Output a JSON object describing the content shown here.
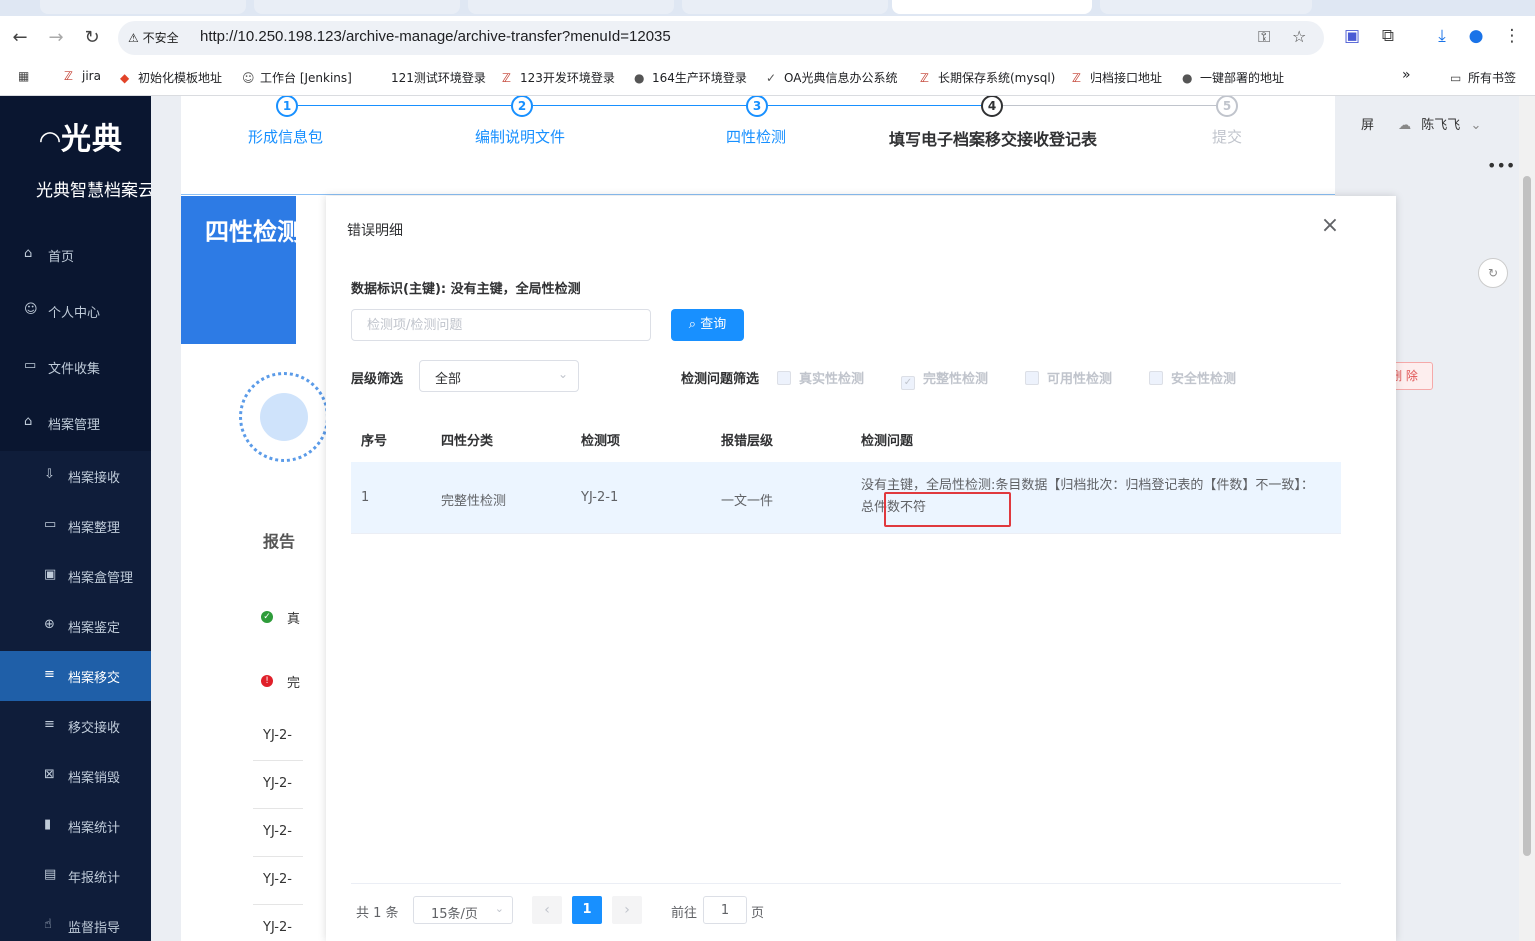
{
  "browser": {
    "insecure_label": "不安全",
    "url": "http://10.250.198.123/archive-manage/archive-transfer?menuId=12035",
    "bookmarks": [
      "jira",
      "初始化模板地址",
      "工作台 [Jenkins]",
      "121测试环境登录",
      "123开发环境登录",
      "164生产环境登录",
      "OA光典信息办公系统",
      "长期保存系统(mysql)",
      "归档接口地址",
      "一键部署的地址"
    ],
    "all_bookmarks": "所有书签",
    "more": "»"
  },
  "sidebar": {
    "logo": "光典",
    "subtitle": "光典智慧档案云",
    "items": [
      {
        "label": "首页",
        "icon": "home-icon",
        "glyph": "⌂"
      },
      {
        "label": "个人中心",
        "icon": "user-icon",
        "glyph": "☺"
      },
      {
        "label": "文件收集",
        "icon": "briefcase-icon",
        "glyph": "▭"
      },
      {
        "label": "档案管理",
        "icon": "bank-icon",
        "glyph": "⌂"
      }
    ],
    "sub_items": [
      {
        "label": "档案接收",
        "icon": "receive-icon",
        "glyph": "⇩"
      },
      {
        "label": "档案整理",
        "icon": "folder-icon",
        "glyph": "▭"
      },
      {
        "label": "档案盒管理",
        "icon": "box-icon",
        "glyph": "▣"
      },
      {
        "label": "档案鉴定",
        "icon": "appraise-icon",
        "glyph": "⊕"
      },
      {
        "label": "档案移交",
        "icon": "list-icon",
        "glyph": "≡"
      },
      {
        "label": "移交接收",
        "icon": "list-icon",
        "glyph": "≡"
      },
      {
        "label": "档案销毁",
        "icon": "destroy-icon",
        "glyph": "⊠"
      },
      {
        "label": "档案统计",
        "icon": "chart-icon",
        "glyph": "▮"
      },
      {
        "label": "年报统计",
        "icon": "report-icon",
        "glyph": "▤"
      },
      {
        "label": "监督指导",
        "icon": "guide-icon",
        "glyph": "☝"
      }
    ]
  },
  "header": {
    "fullscreen": "屏",
    "user": "陈飞飞",
    "delete_label": "删 除"
  },
  "steps": [
    {
      "num": "1",
      "label": "形成信息包"
    },
    {
      "num": "2",
      "label": "编制说明文件"
    },
    {
      "num": "3",
      "label": "四性检测"
    },
    {
      "num": "4",
      "label": "填写电子档案移交接收登记表"
    },
    {
      "num": "5",
      "label": "提交"
    }
  ],
  "background": {
    "banner": "四性检测",
    "report_label": "报告",
    "status_1": "真",
    "status_2": "完",
    "yj_rows": [
      "YJ-2-",
      "YJ-2-",
      "YJ-2-",
      "YJ-2-",
      "YJ-2-"
    ]
  },
  "dialog": {
    "title": "错误明细",
    "data_key": "数据标识(主键): 没有主键，全局性检测",
    "search_placeholder": "检测项/检测问题",
    "search_value": "",
    "query_label": "查询",
    "level_filter_label": "层级筛选",
    "level_value": "全部",
    "issue_filter_label": "检测问题筛选",
    "checkboxes": [
      {
        "label": "真实性检测",
        "checked": false
      },
      {
        "label": "完整性检测",
        "checked": true
      },
      {
        "label": "可用性检测",
        "checked": false
      },
      {
        "label": "安全性检测",
        "checked": false
      }
    ],
    "columns": [
      "序号",
      "四性分类",
      "检测项",
      "报错层级",
      "检测问题"
    ],
    "rows": [
      {
        "index": "1",
        "category": "完整性检测",
        "item": "YJ-2-1",
        "level": "一文一件",
        "problem": "没有主键，全局性检测:条目数据【归档批次：归档登记表的【件数】不一致】：总件数不符"
      }
    ],
    "pagination": {
      "total": "共 1 条",
      "page_size": "15条/页",
      "prev": "‹",
      "current_page": "1",
      "next": "›",
      "goto_prefix": "前往",
      "goto_value": "1",
      "goto_suffix": "页"
    }
  }
}
